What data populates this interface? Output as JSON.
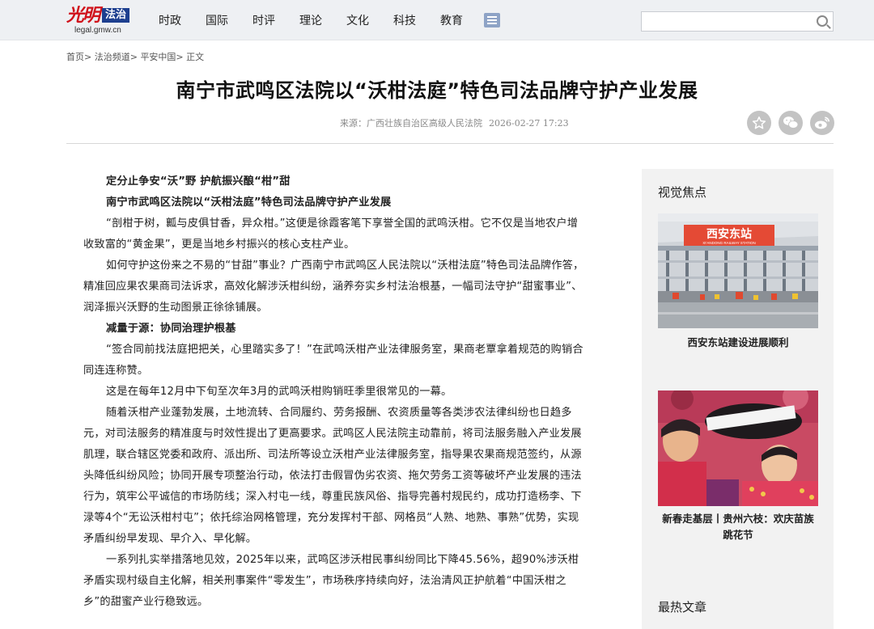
{
  "logo": {
    "calligraphy": "光明",
    "badge": "法治",
    "url": "legal.gmw.cn"
  },
  "nav": [
    "时政",
    "国际",
    "时评",
    "理论",
    "文化",
    "科技",
    "教育"
  ],
  "search": {
    "placeholder": ""
  },
  "breadcrumb": [
    "首页>",
    "法治频道>",
    "平安中国>",
    "正文"
  ],
  "article": {
    "title": "南宁市武鸣区法院以“沃柑法庭”特色司法品牌守护产业发展",
    "source": "来源：广西壮族自治区高级人民法院",
    "time": "2026-02-27 17:23",
    "paragraphs": [
      {
        "bold": true,
        "text": "定分止争安“沃”野 护航振兴酿“柑”甜"
      },
      {
        "bold": true,
        "text": "南宁市武鸣区法院以“沃柑法庭”特色司法品牌守护产业发展"
      },
      {
        "bold": false,
        "text": "“剖柑于树，瓤与皮俱甘香，异众柑。”这便是徐霞客笔下享誉全国的武鸣沃柑。它不仅是当地农户增收致富的“黄金果”，更是当地乡村振兴的核心支柱产业。"
      },
      {
        "bold": false,
        "text": "如何守护这份来之不易的“甘甜”事业？广西南宁市武鸣区人民法院以“沃柑法庭”特色司法品牌作答，精准回应果农果商司法诉求，高效化解涉沃柑纠纷，涵养夯实乡村法治根基，一幅司法守护“甜蜜事业”、润泽振兴沃野的生动图景正徐徐铺展。"
      },
      {
        "bold": true,
        "text": "减量于源：协同治理护根基"
      },
      {
        "bold": false,
        "text": "“签合同前找法庭把把关，心里踏实多了！”在武鸣沃柑产业法律服务室，果商老覃拿着规范的购销合同连连称赞。"
      },
      {
        "bold": false,
        "text": "这是在每年12月中下旬至次年3月的武鸣沃柑购销旺季里很常见的一幕。"
      },
      {
        "bold": false,
        "text": "随着沃柑产业蓬勃发展，土地流转、合同履约、劳务报酬、农资质量等各类涉农法律纠纷也日趋多元，对司法服务的精准度与时效性提出了更高要求。武鸣区人民法院主动靠前，将司法服务融入产业发展肌理，联合辖区党委和政府、派出所、司法所等设立沃柑产业法律服务室，指导果农果商规范签约，从源头降低纠纷风险；协同开展专项整治行动，依法打击假冒伪劣农资、拖欠劳务工资等破坏产业发展的违法行为，筑牢公平诚信的市场防线；深入村屯一线，尊重民族风俗、指导完善村规民约，成功打造杨李、下渌等4个“无讼沃柑村屯”；依托综治网格管理，充分发挥村干部、网格员“人熟、地熟、事熟”优势，实现矛盾纠纷早发现、早介入、早化解。"
      },
      {
        "bold": false,
        "text": "一系列扎实举措落地见效，2025年以来，武鸣区涉沃柑民事纠纷同比下降45.56%，超90%涉沃柑矛盾实现村级自主化解，相关刑事案件“零发生”，市场秩序持续向好，法治清风正护航着“中国沃柑之乡”的甜蜜产业行稳致远。"
      }
    ]
  },
  "sidebar": {
    "visual_title": "视觉焦点",
    "items": [
      {
        "caption": "西安东站建设进展顺利",
        "sign_cn": "西安东站",
        "sign_en": "XI'ANDONG RAILWAY STATION"
      },
      {
        "caption": "新春走基层丨贵州六枝：欢庆苗族跳花节"
      }
    ],
    "hot_title": "最热文章"
  },
  "colors": {
    "brand_red": "#d0121b",
    "brand_blue": "#1d3f8f",
    "share_grey": "#c3c3c3"
  }
}
